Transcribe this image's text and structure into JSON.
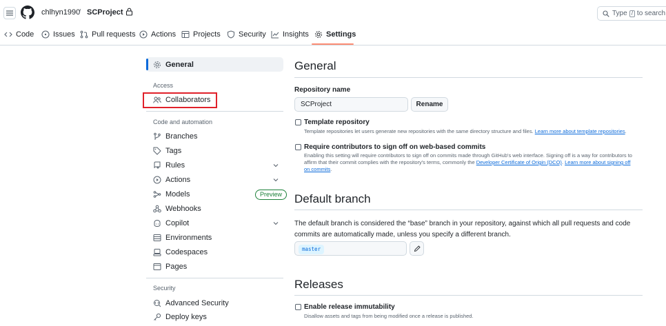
{
  "header": {
    "owner": "chlhyn1990",
    "separator": "/",
    "repo": "SCProject",
    "search": {
      "prefix": "Type",
      "key": "/",
      "suffix": "to search"
    }
  },
  "repo_nav": {
    "items": [
      {
        "label": "Code",
        "icon": "code-icon"
      },
      {
        "label": "Issues",
        "icon": "issue-opened-icon"
      },
      {
        "label": "Pull requests",
        "icon": "git-pull-request-icon"
      },
      {
        "label": "Actions",
        "icon": "play-icon"
      },
      {
        "label": "Projects",
        "icon": "table-icon"
      },
      {
        "label": "Security",
        "icon": "shield-icon"
      },
      {
        "label": "Insights",
        "icon": "graph-icon"
      },
      {
        "label": "Settings",
        "icon": "gear-icon",
        "active": true
      }
    ]
  },
  "sidebar": {
    "general": "General",
    "access_heading": "Access",
    "collaborators": "Collaborators",
    "code_heading": "Code and automation",
    "items": [
      {
        "label": "Branches",
        "icon": "git-branch-icon"
      },
      {
        "label": "Tags",
        "icon": "tag-icon"
      },
      {
        "label": "Rules",
        "icon": "repo-push-icon",
        "expandable": true
      },
      {
        "label": "Actions",
        "icon": "play-icon",
        "expandable": true
      },
      {
        "label": "Models",
        "icon": "ai-model-icon",
        "badge": "Preview"
      },
      {
        "label": "Webhooks",
        "icon": "webhook-icon"
      },
      {
        "label": "Copilot",
        "icon": "copilot-icon",
        "expandable": true
      },
      {
        "label": "Environments",
        "icon": "server-icon"
      },
      {
        "label": "Codespaces",
        "icon": "codespaces-icon"
      },
      {
        "label": "Pages",
        "icon": "browser-icon"
      }
    ],
    "security_heading": "Security",
    "security_items": [
      {
        "label": "Advanced Security",
        "icon": "codescan-icon"
      },
      {
        "label": "Deploy keys",
        "icon": "key-icon"
      }
    ]
  },
  "main": {
    "general_title": "General",
    "repo_name_label": "Repository name",
    "repo_name_value": "SCProject",
    "rename_button": "Rename",
    "template": {
      "title": "Template repository",
      "desc": "Template repositories let users generate new repositories with the same directory structure and files.",
      "link": "Learn more about template repositories",
      "end": "."
    },
    "signoff": {
      "title": "Require contributors to sign off on web-based commits",
      "desc1": "Enabling this setting will require contributors to sign off on commits made through GitHub's web interface. Signing off is a way for contributors to affirm that their commit complies with the repository's terms, commonly the",
      "link1": "Developer Certificate of Origin (DCO)",
      "mid": ".",
      "link2": "Learn more about signing off on commits",
      "end": "."
    },
    "default_branch_title": "Default branch",
    "default_branch_desc": "The default branch is considered the “base” branch in your repository, against which all pull requests and code commits are automatically made, unless you specify a different branch.",
    "default_branch_value": "master",
    "releases_title": "Releases",
    "immutability": {
      "title": "Enable release immutability",
      "desc": "Disallow assets and tags from being modified once a release is published."
    }
  },
  "colors": {
    "accent": "#0969da",
    "tab_underline": "#fd8c73",
    "highlight": "#e0202a",
    "badge_green": "#1a7f37"
  }
}
